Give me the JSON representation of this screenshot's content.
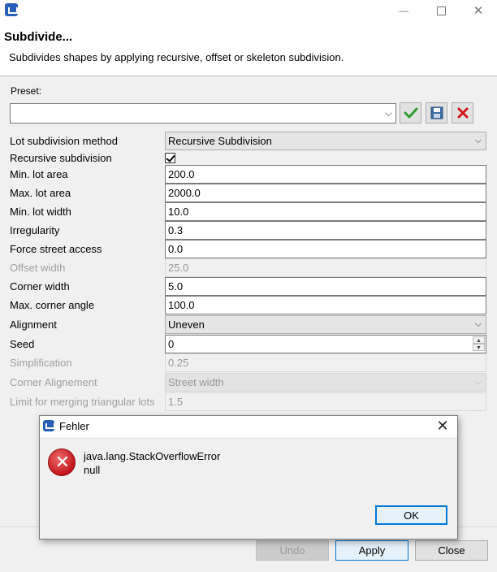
{
  "window": {
    "title_icon": "app-icon",
    "controls": {
      "minimize": "—",
      "close": "✕"
    }
  },
  "header": {
    "title": "Subdivide...",
    "description": "Subdivides shapes by applying recursive, offset or skeleton subdivision."
  },
  "preset": {
    "label": "Preset:",
    "value": "",
    "icons": [
      "apply-preset-icon",
      "save-preset-icon",
      "delete-preset-icon"
    ]
  },
  "properties": [
    {
      "label": "Lot subdivision method",
      "type": "combo",
      "value": "Recursive Subdivision",
      "disabled": false
    },
    {
      "label": "Recursive subdivision",
      "type": "checkbox",
      "value": "checked",
      "disabled": false
    },
    {
      "label": "Min. lot area",
      "type": "text",
      "value": "200.0",
      "disabled": false
    },
    {
      "label": "Max. lot area",
      "type": "text",
      "value": "2000.0",
      "disabled": false
    },
    {
      "label": "Min. lot width",
      "type": "text",
      "value": "10.0",
      "disabled": false
    },
    {
      "label": "Irregularity",
      "type": "text",
      "value": "0.3",
      "disabled": false
    },
    {
      "label": "Force street access",
      "type": "text",
      "value": "0.0",
      "disabled": false
    },
    {
      "label": "Offset width",
      "type": "text",
      "value": "25.0",
      "disabled": true
    },
    {
      "label": "Corner width",
      "type": "text",
      "value": "5.0",
      "disabled": false
    },
    {
      "label": "Max. corner angle",
      "type": "text",
      "value": "100.0",
      "disabled": false
    },
    {
      "label": "Alignment",
      "type": "combo",
      "value": "Uneven",
      "disabled": false
    },
    {
      "label": "Seed",
      "type": "spinner",
      "value": "0",
      "disabled": false
    },
    {
      "label": "Simplification",
      "type": "text",
      "value": "0.25",
      "disabled": true
    },
    {
      "label": "Corner Alignement",
      "type": "combo",
      "value": "Street width",
      "disabled": true
    },
    {
      "label": "Limit for merging triangular lots",
      "type": "text",
      "value": "1.5",
      "disabled": true
    }
  ],
  "buttons": {
    "undo": "Undo",
    "apply": "Apply",
    "close": "Close"
  },
  "error_dialog": {
    "title": "Fehler",
    "message_line1": "java.lang.StackOverflowError",
    "message_line2": "null",
    "ok_label": "OK",
    "close_glyph": "✕"
  },
  "colors": {
    "accent": "#0078d7",
    "error": "#c0161b"
  }
}
